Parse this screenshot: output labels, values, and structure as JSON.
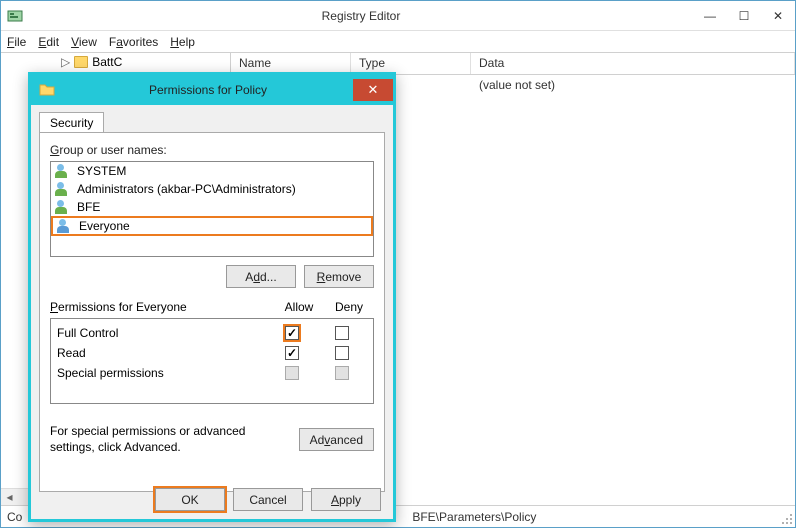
{
  "main": {
    "title": "Registry Editor",
    "menu": {
      "file": "File",
      "edit": "Edit",
      "view": "View",
      "favorites": "Favorites",
      "help": "Help"
    },
    "tree": {
      "visible_item": "BattC"
    },
    "list": {
      "columns": {
        "name": "Name",
        "type": "Type",
        "data": "Data"
      },
      "rows": [
        {
          "data": "(value not set)"
        }
      ]
    },
    "statusbar_suffix": "BFE\\Parameters\\Policy",
    "statusbar_prefix": "Co"
  },
  "dialog": {
    "title": "Permissions for Policy",
    "tab": "Security",
    "group_label": "Group or user names:",
    "groups": [
      {
        "label": "SYSTEM"
      },
      {
        "label": "Administrators (akbar-PC\\Administrators)"
      },
      {
        "label": "BFE"
      },
      {
        "label": "Everyone",
        "selected": true
      }
    ],
    "add_btn": "Add...",
    "remove_btn": "Remove",
    "perm_for_label": "Permissions for Everyone",
    "perm_cols": {
      "allow": "Allow",
      "deny": "Deny"
    },
    "perms": [
      {
        "name": "Full Control",
        "allow": true,
        "deny": false,
        "allow_highlight": true
      },
      {
        "name": "Read",
        "allow": true,
        "deny": false
      },
      {
        "name": "Special permissions",
        "allow": false,
        "deny": false,
        "disabled": true
      }
    ],
    "advanced_text": "For special permissions or advanced settings, click Advanced.",
    "advanced_btn": "Advanced",
    "ok": "OK",
    "cancel": "Cancel",
    "apply": "Apply"
  }
}
